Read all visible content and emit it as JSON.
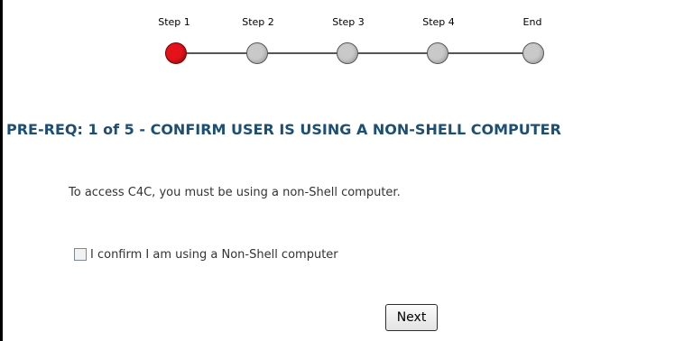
{
  "progress": {
    "current_step_index": 0,
    "steps": [
      {
        "label": "Step 1",
        "state": "active"
      },
      {
        "label": "Step 2",
        "state": "inactive"
      },
      {
        "label": "Step 3",
        "state": "inactive"
      },
      {
        "label": "Step 4",
        "state": "inactive"
      },
      {
        "label": "End",
        "state": "inactive"
      }
    ],
    "active_color": "#e4121b",
    "inactive_color": "#c9c9c9"
  },
  "page": {
    "heading": "PRE-REQ: 1 of 5 - CONFIRM USER IS USING A NON-SHELL COMPUTER",
    "heading_color": "#1d4f73",
    "message": "To access C4C, you must be using a non-Shell computer."
  },
  "confirm": {
    "label": "I confirm I am using a Non-Shell computer",
    "checked": false
  },
  "actions": {
    "next_label": "Next"
  }
}
